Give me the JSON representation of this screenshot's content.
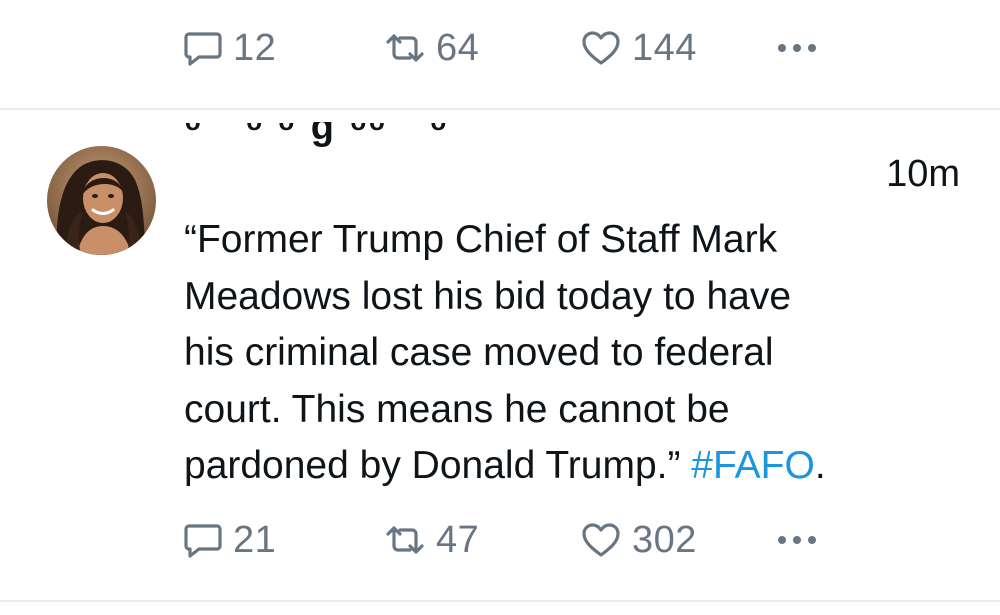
{
  "tweet_prev": {
    "replies": "12",
    "retweets": "64",
    "likes": "144"
  },
  "tweet": {
    "handle_fragment": "ᵕ ˜ ᵕ ᵕ ɠ ᵕᵕ ˜  ᵕ",
    "timestamp": "10m",
    "lines": [
      "“Former Trump Chief of Staff Mark",
      "Meadows lost his bid today to have",
      "his criminal case moved to federal",
      "court.  This means he cannot be"
    ],
    "last_line_text": "pardoned by Donald Trump.” ",
    "hashtag": "#FAFO",
    "trailing": ".",
    "replies": "21",
    "retweets": "47",
    "likes": "302"
  },
  "colors": {
    "text": "#0f1419",
    "muted": "#687684",
    "link": "#1b95e0",
    "divider": "#e6ecf0"
  },
  "icons": [
    "reply-icon",
    "retweet-icon",
    "like-icon",
    "more-icon"
  ]
}
